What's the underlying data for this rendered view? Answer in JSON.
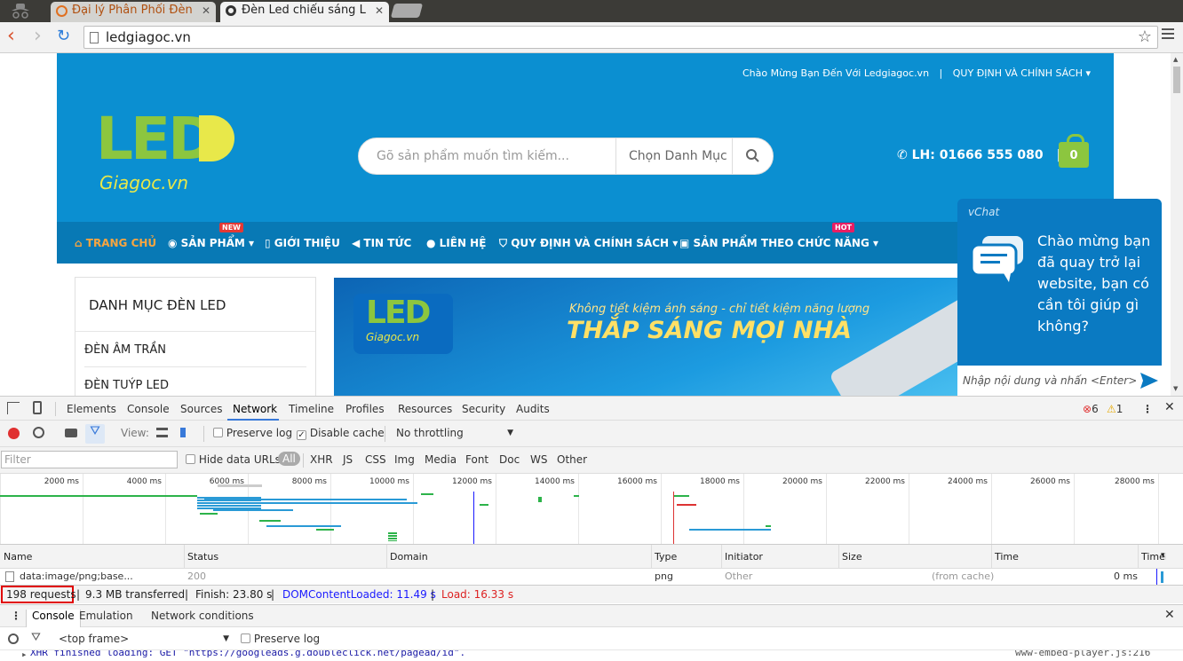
{
  "browser": {
    "tabs": [
      {
        "title": "Đại lý Phân Phối Đèn",
        "active": false
      },
      {
        "title": "Đèn Led chiếu sáng L",
        "active": true
      }
    ],
    "url": "ledgiagoc.vn"
  },
  "site": {
    "topbar_welcome": "Chào Mừng Bạn Đến Với Ledgiagoc.vn",
    "topbar_policy": "QUY ĐỊNH VÀ CHÍNH SÁCH",
    "logo_main": "LED",
    "logo_sub": "Giagoc.vn",
    "search_placeholder": "Gõ sản phẩm muốn tìm kiếm...",
    "search_category": "Chọn Danh Mục",
    "phone": "LH: 01666 555 080",
    "cart_count": "0",
    "nav": [
      {
        "label": "TRANG CHỦ",
        "badge": ""
      },
      {
        "label": "SẢN PHẨM",
        "badge": "NEW"
      },
      {
        "label": "GIỚI THIỆU",
        "badge": ""
      },
      {
        "label": "TIN TỨC",
        "badge": ""
      },
      {
        "label": "LIÊN HỆ",
        "badge": ""
      },
      {
        "label": "QUY ĐỊNH VÀ CHÍNH SÁCH",
        "badge": ""
      },
      {
        "label": "SẢN PHẨM THEO CHỨC NĂNG",
        "badge": "HOT"
      }
    ],
    "sidebar_title": "DANH MỤC ĐÈN LED",
    "sidebar_items": [
      "ĐÈN ÂM TRẦN",
      "ĐÈN TUÝP LED"
    ],
    "banner_tagline": "Không tiết kiệm ánh sáng - chỉ tiết kiệm năng lượng",
    "banner_headline": "THẮP SÁNG MỌI NHÀ",
    "banner_logo_main": "LED",
    "banner_logo_sub": "Giagoc.vn"
  },
  "vchat": {
    "brand": "vChat",
    "message": "Chào mừng bạn đã quay trở lại website, bạn có cần tôi giúp gì không?",
    "input_placeholder": "Nhập nội dung và nhấn <Enter>"
  },
  "devtools": {
    "tabs": [
      "Elements",
      "Console",
      "Sources",
      "Network",
      "Timeline",
      "Profiles",
      "Resources",
      "Security",
      "Audits"
    ],
    "active_tab": "Network",
    "errors": "6",
    "warnings": "1",
    "view_label": "View:",
    "preserve_log": "Preserve log",
    "disable_cache": "Disable cache",
    "throttling": "No throttling",
    "filter_placeholder": "Filter",
    "hide_data_urls": "Hide data URLs",
    "type_filters": [
      "All",
      "XHR",
      "JS",
      "CSS",
      "Img",
      "Media",
      "Font",
      "Doc",
      "WS",
      "Other"
    ],
    "timeline_ticks": [
      "2000 ms",
      "4000 ms",
      "6000 ms",
      "8000 ms",
      "10000 ms",
      "12000 ms",
      "14000 ms",
      "16000 ms",
      "18000 ms",
      "20000 ms",
      "22000 ms",
      "24000 ms",
      "26000 ms",
      "28000 ms"
    ],
    "columns": [
      "Name",
      "Status",
      "Domain",
      "Type",
      "Initiator",
      "Size",
      "Time",
      "Timeline"
    ],
    "row": {
      "name": "data:image/png;base...",
      "status": "200",
      "domain": "",
      "type": "png",
      "initiator": "Other",
      "size": "(from cache)",
      "time": "0 ms"
    },
    "summary": {
      "requests": "198 requests",
      "transferred": "9.3 MB transferred",
      "finish": "Finish: 23.80 s",
      "dom": "DOMContentLoaded: 11.49 s",
      "load": "Load: 16.33 s"
    },
    "drawer_tabs": [
      "Console",
      "Emulation",
      "Network conditions"
    ],
    "console_context": "<top frame>",
    "console_preserve": "Preserve log",
    "console_line": "XHR finished loading: GET \"https://googleads.g.doubleclick.net/pagead/id\".",
    "console_source": "www-embed-player.js:216"
  },
  "colors": {
    "header_blue": "#0b8fd1",
    "nav_blue": "#0879b5",
    "accent_green": "#8cc63f",
    "dom_blue": "#1a1aff",
    "load_red": "#d22"
  }
}
